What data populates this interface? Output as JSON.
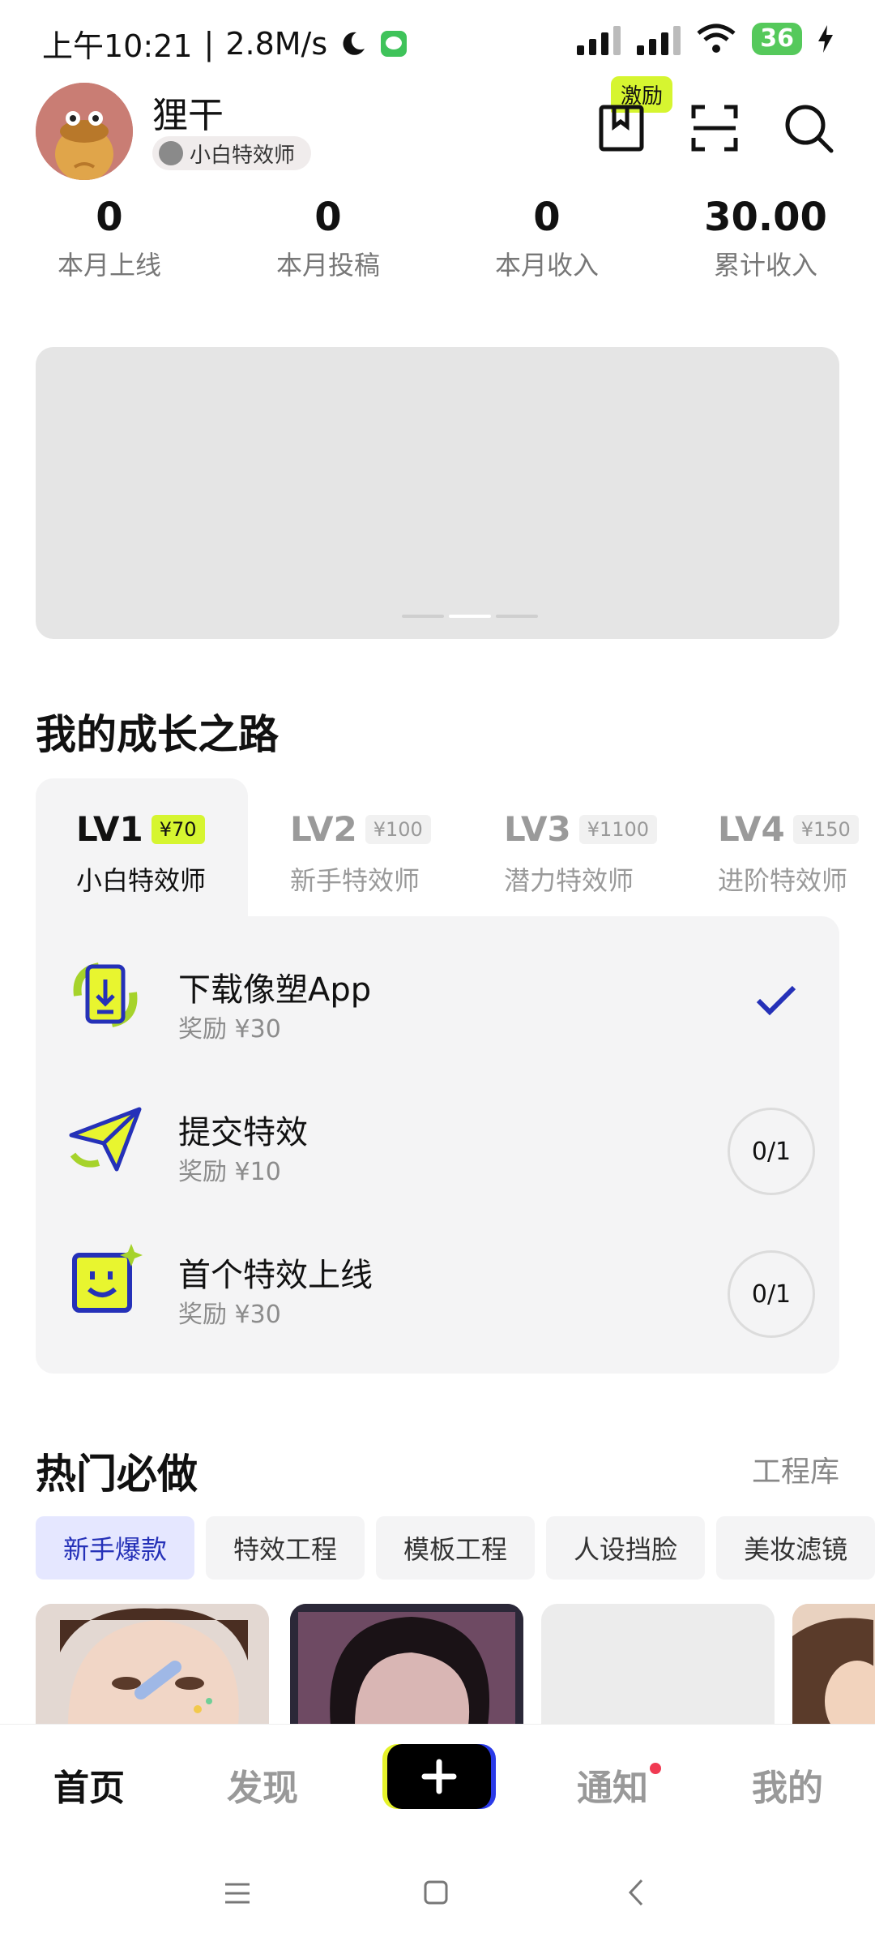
{
  "status_bar": {
    "time": "上午10:21",
    "separator": "|",
    "speed": "2.8M/s",
    "battery": "36"
  },
  "header": {
    "username": "狸干",
    "level_badge": "小白特效师",
    "reward_tag": "激励"
  },
  "stats": [
    {
      "value": "0",
      "label": "本月上线"
    },
    {
      "value": "0",
      "label": "本月投稿"
    },
    {
      "value": "0",
      "label": "本月收入"
    },
    {
      "value": "30.00",
      "label": "累计收入"
    }
  ],
  "growth": {
    "title": "我的成长之路",
    "levels": [
      {
        "lv": "LV1",
        "amount": "¥70",
        "name": "小白特效师"
      },
      {
        "lv": "LV2",
        "amount": "¥100",
        "name": "新手特效师"
      },
      {
        "lv": "LV3",
        "amount": "¥1100",
        "name": "潜力特效师"
      },
      {
        "lv": "LV4",
        "amount": "¥150",
        "name": "进阶特效师"
      }
    ],
    "tasks": [
      {
        "title": "下载像塑App",
        "reward": "奖励 ¥30",
        "status": "done"
      },
      {
        "title": "提交特效",
        "reward": "奖励 ¥10",
        "progress": "0/1"
      },
      {
        "title": "首个特效上线",
        "reward": "奖励 ¥30",
        "progress": "0/1"
      }
    ]
  },
  "hot": {
    "title": "热门必做",
    "link": "工程库",
    "chips": [
      "新手爆款",
      "特效工程",
      "模板工程",
      "人设挡脸",
      "美妆滤镜"
    ]
  },
  "bottom_nav": {
    "home": "首页",
    "discover": "发现",
    "notify": "通知",
    "mine": "我的"
  },
  "colors": {
    "accent_lime": "#d6f530",
    "accent_blue": "#2a3ae8",
    "check_blue": "#2531b8",
    "badge_red": "#f03a52"
  }
}
